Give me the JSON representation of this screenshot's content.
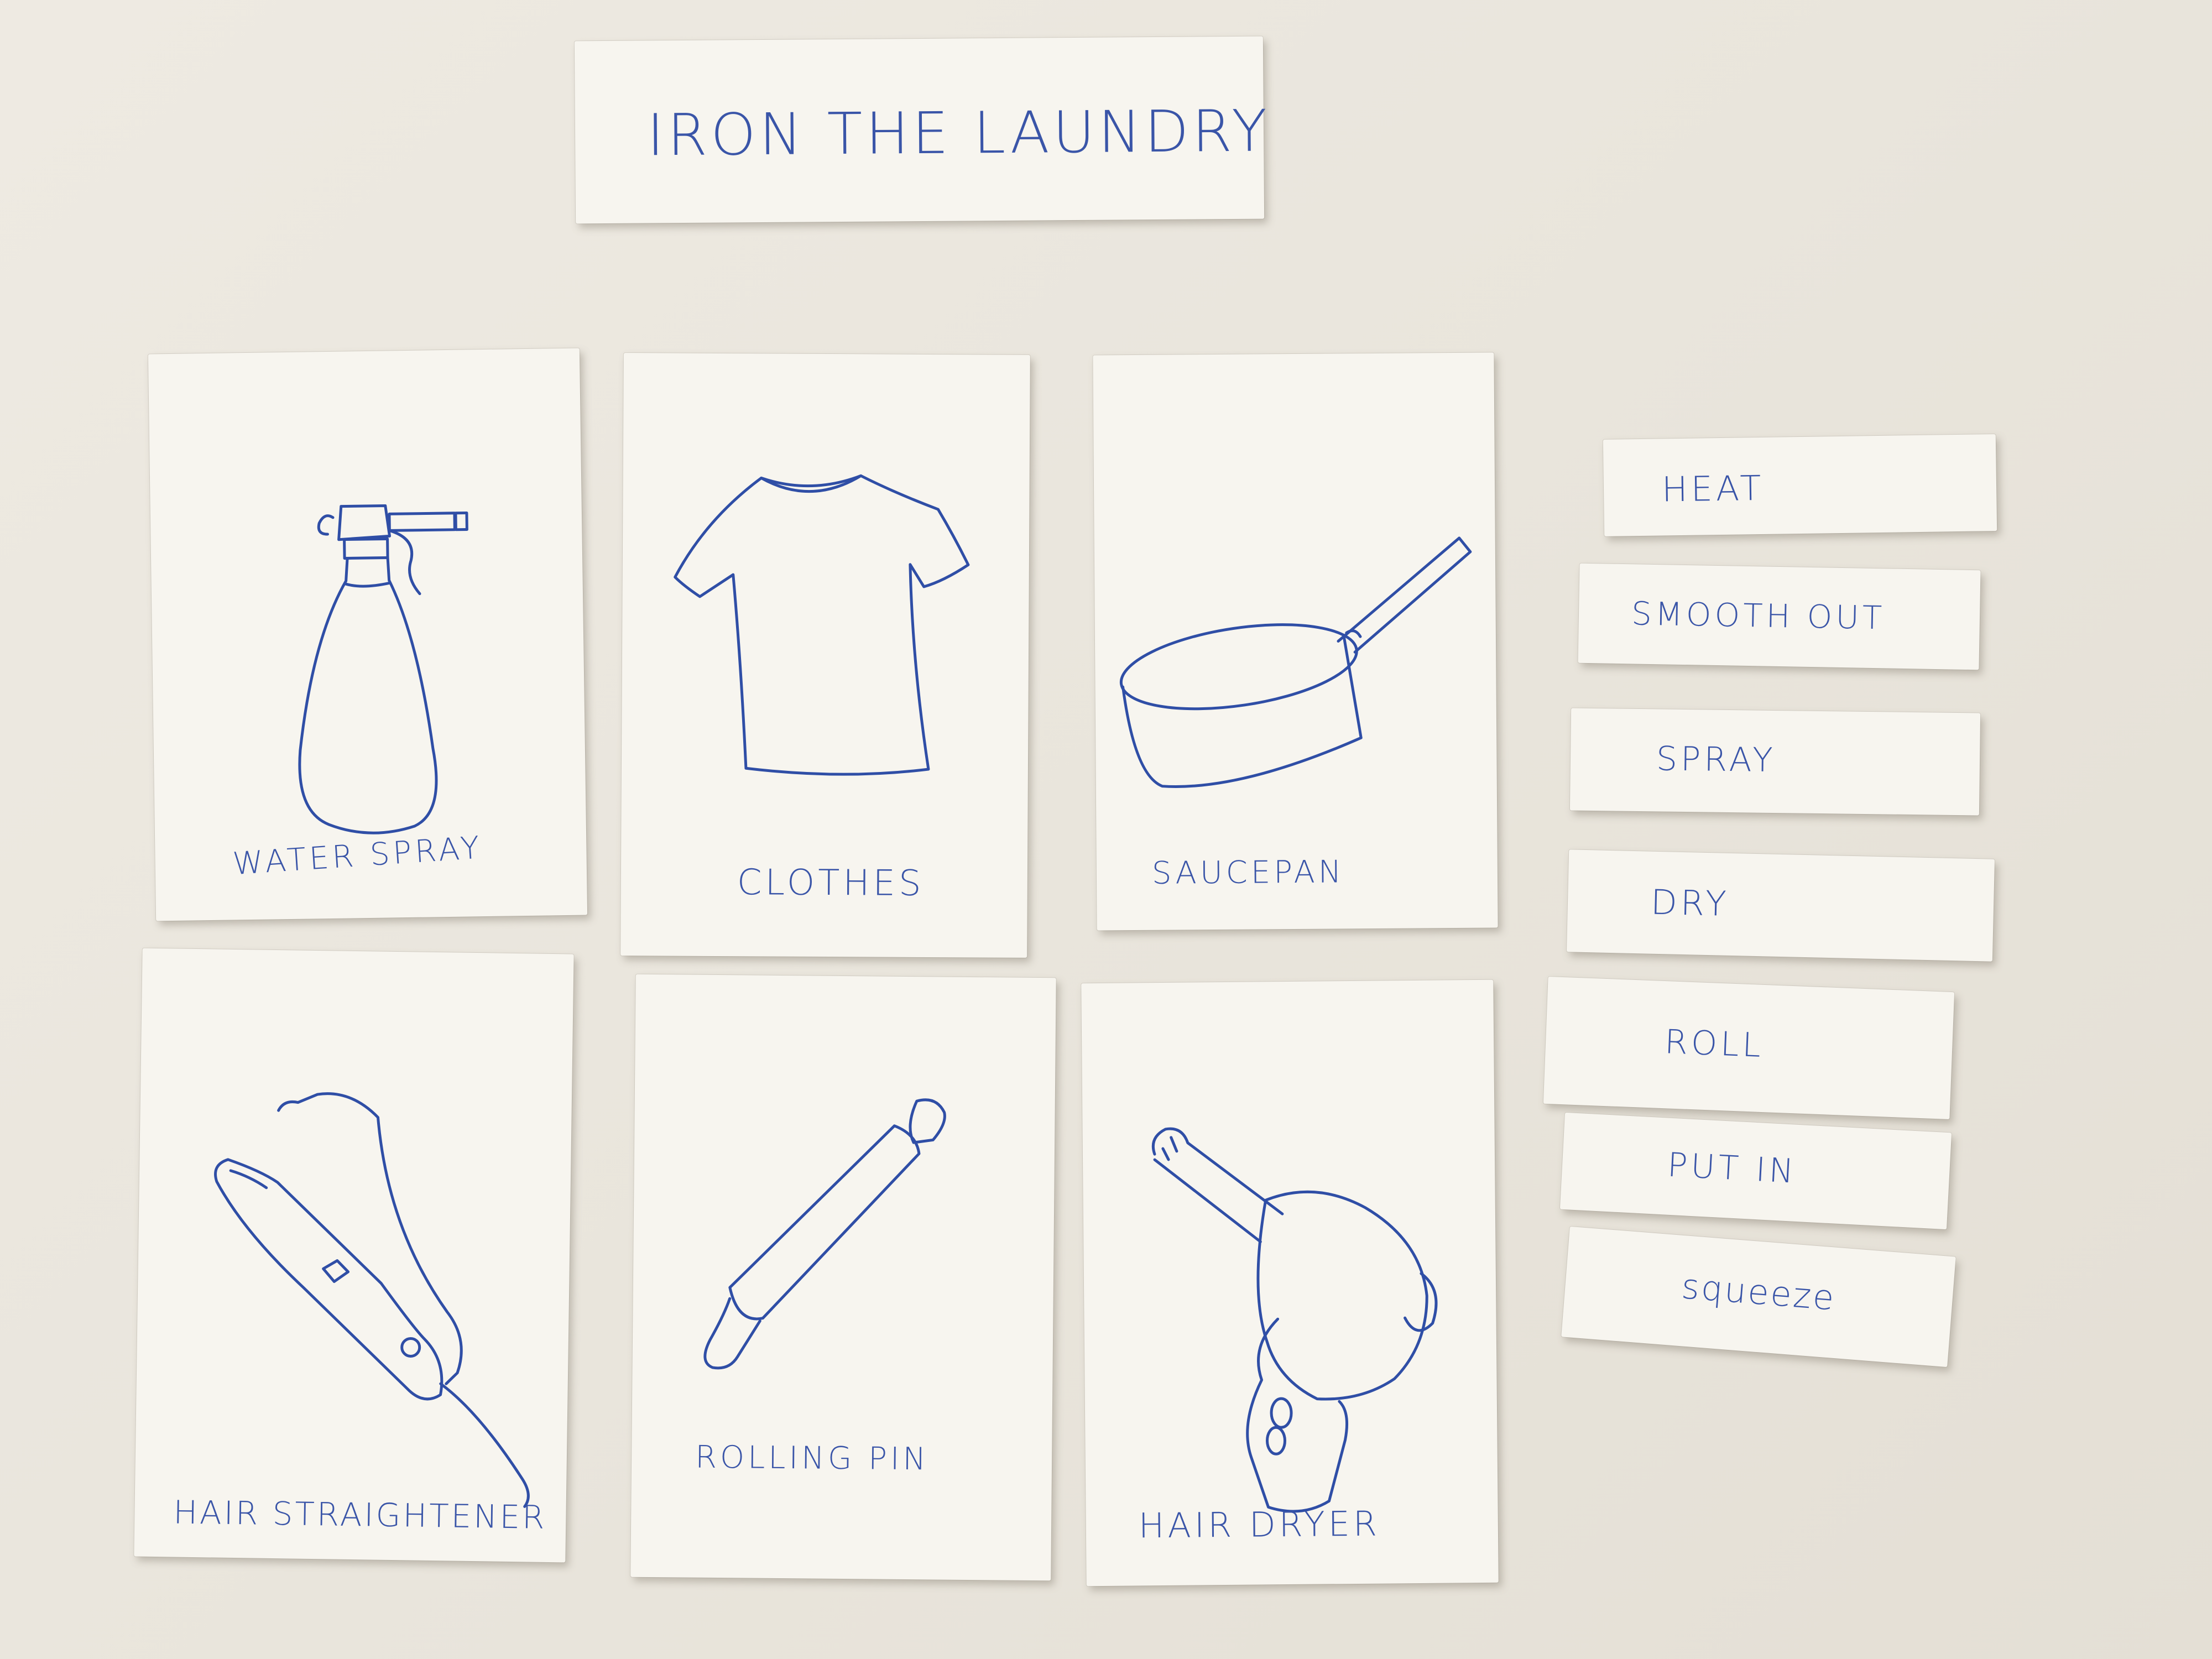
{
  "title_strip": {
    "text": "IRON THE LAUNDRY"
  },
  "cards": [
    {
      "label": "WATER SPRAY",
      "icon": "spray-bottle-icon"
    },
    {
      "label": "CLOTHES",
      "icon": "t-shirt-icon"
    },
    {
      "label": "SAUCEPAN",
      "icon": "saucepan-icon"
    },
    {
      "label": "HAIR STRAIGHTENER",
      "icon": "hair-straightener-icon"
    },
    {
      "label": "ROLLING PIN",
      "icon": "rolling-pin-icon"
    },
    {
      "label": "HAIR DRYER",
      "icon": "hair-dryer-icon"
    }
  ],
  "word_strips": [
    {
      "text": "HEAT"
    },
    {
      "text": "SMOOTH OUT"
    },
    {
      "text": "SPRAY"
    },
    {
      "text": "DRY"
    },
    {
      "text": "ROLL"
    },
    {
      "text": "PUT IN"
    },
    {
      "text": "squeeze"
    }
  ],
  "colors": {
    "ink": "#3a55a8",
    "paper": "#f7f5ef",
    "background": "#ece8df"
  }
}
